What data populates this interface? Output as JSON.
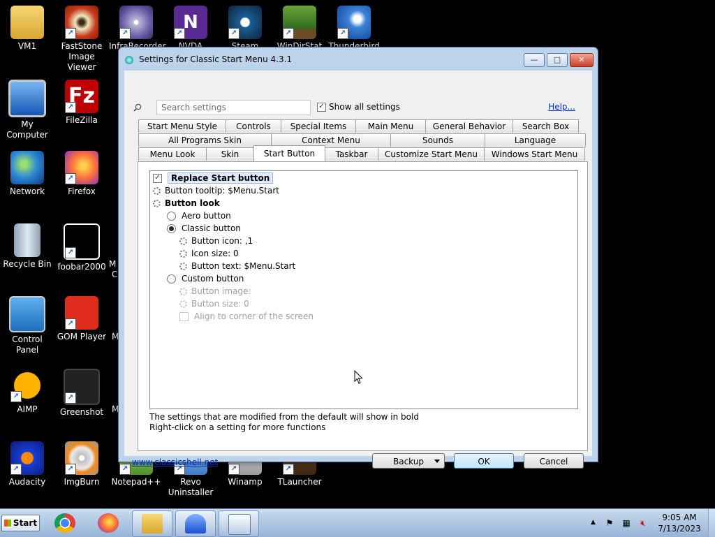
{
  "desktop": {
    "icons": [
      {
        "label": "VM1",
        "icon": "folder-user-icon"
      },
      {
        "label": "FastStone Image Viewer",
        "icon": "faststone-eye-icon"
      },
      {
        "label": "InfraRecorder",
        "icon": "infrarecorder-disc-icon"
      },
      {
        "label": "NVDA",
        "icon": "nvda-icon"
      },
      {
        "label": "Steam",
        "icon": "steam-icon"
      },
      {
        "label": "WinDirStat",
        "icon": "windirstat-tree-icon"
      },
      {
        "label": "Thunderbird",
        "icon": "thunderbird-icon"
      },
      {
        "label": "My Computer",
        "icon": "computer-icon"
      },
      {
        "label": "FileZilla",
        "icon": "filezilla-icon"
      },
      {
        "label": "Network",
        "icon": "network-globe-icon"
      },
      {
        "label": "Firefox",
        "icon": "firefox-icon"
      },
      {
        "label": "Recycle Bin",
        "icon": "recycle-bin-icon"
      },
      {
        "label": "foobar2000",
        "icon": "foobar-cat-icon"
      },
      {
        "label": "Control Panel",
        "icon": "control-panel-icon"
      },
      {
        "label": "GOM Player",
        "icon": "gom-player-icon"
      },
      {
        "label": "AIMP",
        "icon": "aimp-icon"
      },
      {
        "label": "Greenshot",
        "icon": "greenshot-icon"
      },
      {
        "label": "Audacity",
        "icon": "audacity-icon"
      },
      {
        "label": "ImgBurn",
        "icon": "imgburn-icon"
      },
      {
        "label": "Notepad++",
        "icon": "notepadpp-icon"
      },
      {
        "label": "Revo Uninstaller",
        "icon": "revo-icon"
      },
      {
        "label": "Winamp",
        "icon": "winamp-icon"
      },
      {
        "label": "TLauncher",
        "icon": "tlauncher-icon"
      }
    ],
    "partial_labels": [
      "M",
      "C",
      "M",
      "M"
    ]
  },
  "dialog": {
    "title": "Settings for Classic Start Menu 4.3.1",
    "controls": {
      "minimize": "—",
      "maximize": "□",
      "close": "✕"
    },
    "search_placeholder": "Search settings",
    "show_all_label": "Show all settings",
    "show_all_checked": true,
    "help_label": "Help...",
    "tabs": {
      "row1": [
        "Start Menu Style",
        "Controls",
        "Special Items",
        "Main Menu",
        "General Behavior",
        "Search Box"
      ],
      "row2": [
        "All Programs Skin",
        "Context Menu",
        "Sounds",
        "Language"
      ],
      "row3": [
        "Menu Look",
        "Skin",
        "Start Button",
        "Taskbar",
        "Customize Start Menu",
        "Windows Start Menu"
      ],
      "active": "Start Button"
    },
    "settings": {
      "replace_start": "Replace Start button",
      "tooltip": "Button tooltip: $Menu.Start",
      "button_look": "Button look",
      "aero": "Aero button",
      "classic": "Classic button",
      "icon": "Button icon: ,1",
      "icon_size": "Icon size: 0",
      "text": "Button text: $Menu.Start",
      "custom": "Custom button",
      "image": "Button image:",
      "size": "Button size: 0",
      "align": "Align to corner of the screen"
    },
    "notes": {
      "line1": "The settings that are modified from the default will show in bold",
      "line2": "Right-click on a setting for more functions"
    },
    "footer": {
      "link": "www.classicshell.net",
      "backup": "Backup",
      "ok": "OK",
      "cancel": "Cancel"
    }
  },
  "taskbar": {
    "start_label": "Start",
    "pinned": [
      "chrome-icon",
      "firefox-icon",
      "explorer-icon",
      "classic-shell-icon",
      "settings-window-icon"
    ],
    "clock_time": "9:05 AM",
    "clock_date": "7/13/2023",
    "tray": [
      "show-hidden-icons-icon",
      "action-center-flag-icon",
      "network-icon",
      "volume-muted-icon"
    ]
  }
}
